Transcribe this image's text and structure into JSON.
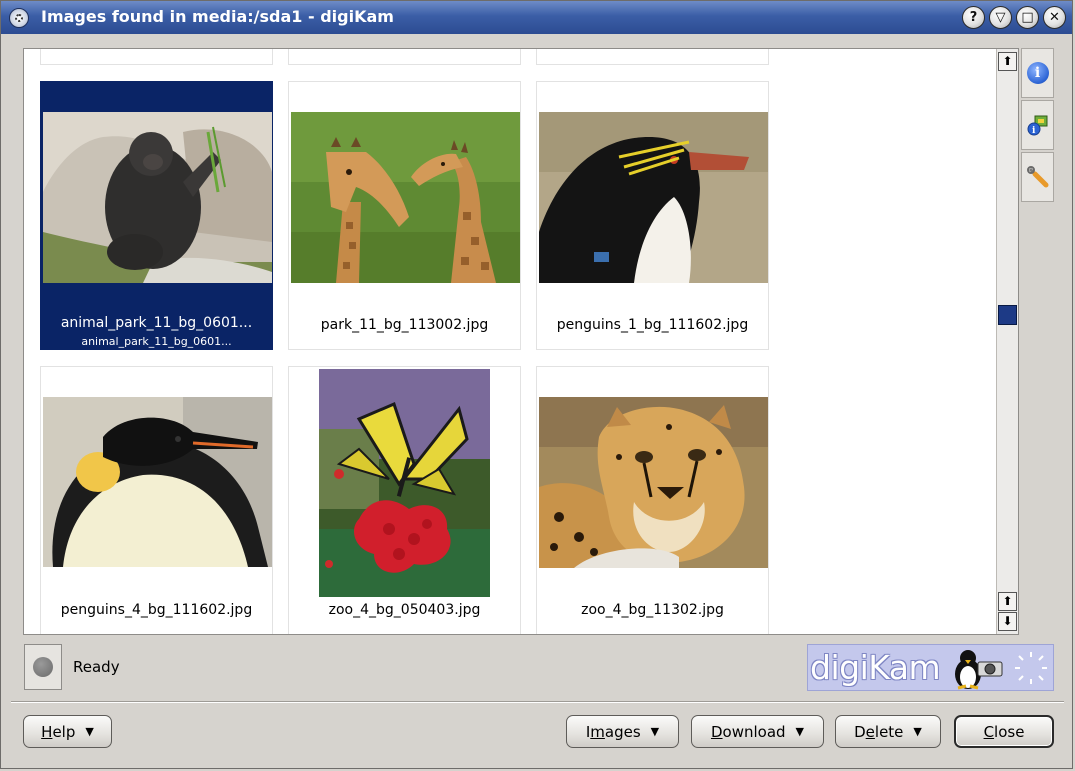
{
  "window": {
    "title": "Images found in media:/sda1 - digiKam",
    "buttons": [
      "?",
      "▽",
      "□",
      "✕"
    ]
  },
  "thumbnails": [
    {
      "filename": "animal_park_11_bg_0601...",
      "subtitle": "animal_park_11_bg_0601...",
      "selected": true,
      "subject": "gorilla"
    },
    {
      "filename": "park_11_bg_113002.jpg",
      "selected": false,
      "subject": "giraffes"
    },
    {
      "filename": "penguins_1_bg_111602.jpg",
      "selected": false,
      "subject": "rockhopper-penguin"
    },
    {
      "filename": "penguins_4_bg_111602.jpg",
      "selected": false,
      "subject": "emperor-penguin"
    },
    {
      "filename": "zoo_4_bg_050403.jpg",
      "selected": false,
      "subject": "butterfly"
    },
    {
      "filename": "zoo_4_bg_11302.jpg",
      "selected": false,
      "subject": "cheetah"
    }
  ],
  "sidebar": {
    "tabs": [
      "info-icon",
      "camera-info-icon",
      "wrench-icon"
    ]
  },
  "status": {
    "text": "Ready"
  },
  "banner": {
    "logo_text": "digiKam"
  },
  "buttons": {
    "help": {
      "label_u": "H",
      "label_rest": "elp"
    },
    "images": {
      "label_pre": "I",
      "label_u": "m",
      "label_rest": "ages"
    },
    "download": {
      "label_u": "D",
      "label_rest": "ownload"
    },
    "delete": {
      "label_pre": "D",
      "label_u": "e",
      "label_rest": "lete"
    },
    "close": {
      "label_u": "C",
      "label_rest": "lose"
    }
  },
  "colors": {
    "titlebar": "#3b5ea6",
    "selection": "#0a2466",
    "background": "#d6d3ce",
    "banner": "#c4c8ec"
  }
}
